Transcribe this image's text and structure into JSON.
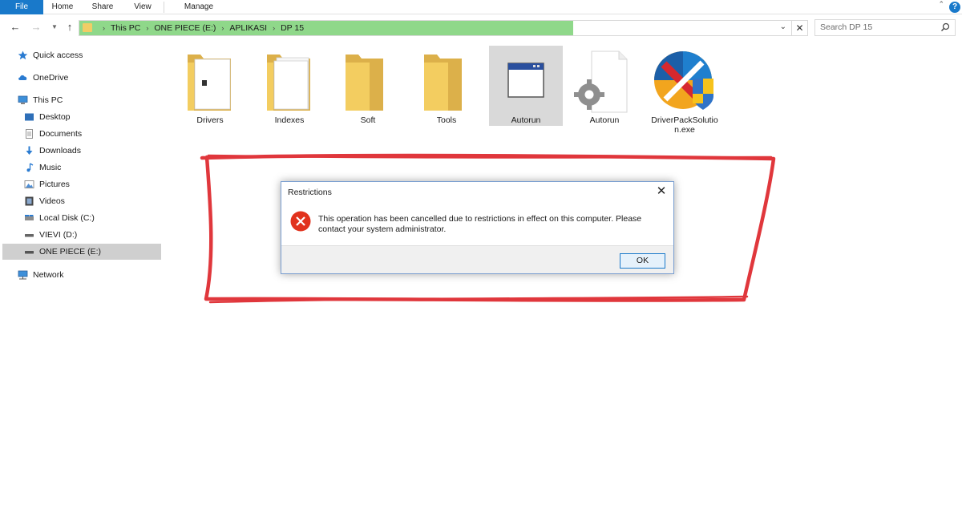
{
  "ribbon": {
    "file": "File",
    "home": "Home",
    "share": "Share",
    "view": "View",
    "manage": "Manage",
    "help": "?"
  },
  "address": {
    "crumbs": [
      "This PC",
      "ONE PIECE (E:)",
      "APLIKASI",
      "DP 15"
    ],
    "highlight_color": "#8fd88a"
  },
  "search": {
    "placeholder": "Search DP 15"
  },
  "sidebar": {
    "items": [
      {
        "label": "Quick access",
        "icon": "star-icon"
      },
      {
        "label": "OneDrive",
        "icon": "cloud-icon"
      },
      {
        "label": "This PC",
        "icon": "computer-icon"
      },
      {
        "label": "Desktop",
        "icon": "desktop-icon"
      },
      {
        "label": "Documents",
        "icon": "documents-icon"
      },
      {
        "label": "Downloads",
        "icon": "download-icon"
      },
      {
        "label": "Music",
        "icon": "music-icon"
      },
      {
        "label": "Pictures",
        "icon": "pictures-icon"
      },
      {
        "label": "Videos",
        "icon": "videos-icon"
      },
      {
        "label": "Local Disk (C:)",
        "icon": "disk-icon"
      },
      {
        "label": "VIEVI (D:)",
        "icon": "drive-icon"
      },
      {
        "label": "ONE PIECE (E:)",
        "icon": "drive-icon",
        "selected": true
      },
      {
        "label": "Network",
        "icon": "network-icon"
      }
    ]
  },
  "files": [
    {
      "name": "Drivers",
      "icon": "folder-icon"
    },
    {
      "name": "Indexes",
      "icon": "folder-icon"
    },
    {
      "name": "Soft",
      "icon": "folder-icon"
    },
    {
      "name": "Tools",
      "icon": "folder-icon"
    },
    {
      "name": "Autorun",
      "icon": "application-window-icon",
      "selected": true
    },
    {
      "name": "Autorun",
      "icon": "settings-file-icon"
    },
    {
      "name": "DriverPackSolution.exe",
      "name_lines": [
        "DriverPackSolutio",
        "n.exe"
      ],
      "icon": "driverpack-logo-icon"
    }
  ],
  "dialog": {
    "title": "Restrictions",
    "message": "This operation has been cancelled due to restrictions in effect on this computer. Please contact your system administrator.",
    "ok_label": "OK",
    "icon": "error-icon"
  },
  "annotation": {
    "color": "#e0373c"
  }
}
